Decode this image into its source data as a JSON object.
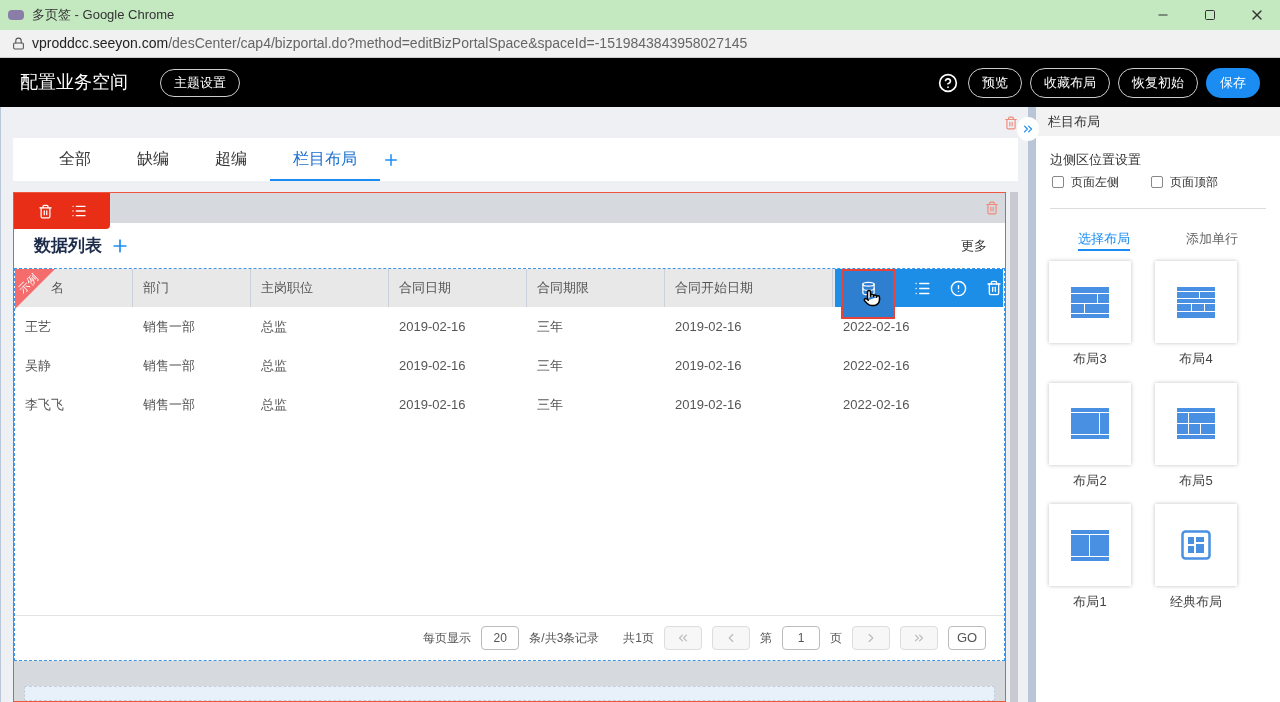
{
  "window": {
    "title": "多页签 - Google Chrome",
    "url_host": "vproddcc.seeyon.com",
    "url_path": "/desCenter/cap4/bizportal.do?method=editBizPortalSpace&spaceId=-1519843843958027145"
  },
  "header": {
    "title": "配置业务空间",
    "theme_button": "主题设置",
    "buttons": [
      {
        "label": "预览",
        "kind": "outline"
      },
      {
        "label": "收藏布局",
        "kind": "outline"
      },
      {
        "label": "恢复初始",
        "kind": "outline"
      },
      {
        "label": "保存",
        "kind": "primary"
      }
    ]
  },
  "tabs": [
    {
      "label": "全部",
      "selected": false
    },
    {
      "label": "缺编",
      "selected": false
    },
    {
      "label": "超编",
      "selected": false
    },
    {
      "label": "栏目布局",
      "selected": true
    }
  ],
  "section": {
    "title": "数据列表",
    "more": "更多",
    "ribbon": "示例",
    "columns": [
      "名",
      "部门",
      "主岗职位",
      "合同日期",
      "合同期限",
      "合同开始日期"
    ],
    "rows": [
      [
        "王艺",
        "销售一部",
        "总监",
        "2019-02-16",
        "三年",
        "2019-02-16",
        "2022-02-16"
      ],
      [
        "吴静",
        "销售一部",
        "总监",
        "2019-02-16",
        "三年",
        "2019-02-16",
        "2022-02-16"
      ],
      [
        "李飞飞",
        "销售一部",
        "总监",
        "2019-02-16",
        "三年",
        "2019-02-16",
        "2022-02-16"
      ]
    ],
    "pagination": {
      "per_page_label": "每页显示",
      "per_page": "20",
      "records": "条/共3条记录",
      "pages": "共1页",
      "page_prefix": "第",
      "page": "1",
      "page_suffix": "页",
      "go": "GO"
    }
  },
  "panel": {
    "title": "栏目布局",
    "side_label": "边侧区位置设置",
    "options": [
      {
        "label": "页面左侧",
        "checked": false
      },
      {
        "label": "页面顶部",
        "checked": false
      }
    ],
    "subtabs": [
      {
        "label": "选择布局",
        "selected": true
      },
      {
        "label": "添加单行",
        "selected": false
      }
    ],
    "layouts": [
      {
        "label": "布局3",
        "kind": "l3"
      },
      {
        "label": "布局4",
        "kind": "l4"
      },
      {
        "label": "布局2",
        "kind": "l2"
      },
      {
        "label": "布局5",
        "kind": "l5"
      },
      {
        "label": "布局1",
        "kind": "l1"
      },
      {
        "label": "经典布局",
        "kind": "classic"
      }
    ]
  }
}
